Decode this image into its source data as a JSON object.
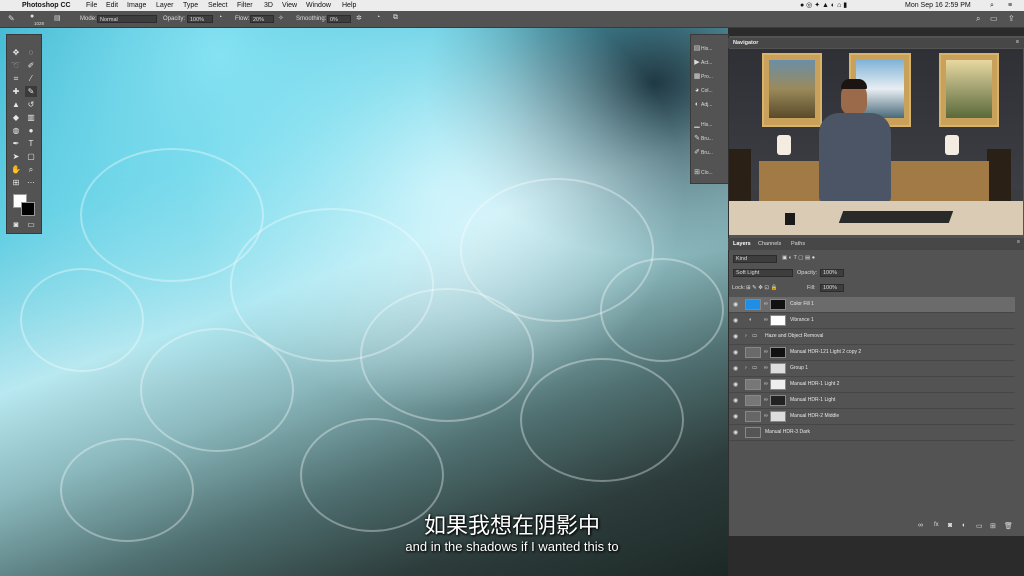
{
  "menubar": {
    "app_name": "Photoshop CC",
    "items": [
      "File",
      "Edit",
      "Image",
      "Layer",
      "Type",
      "Select",
      "Filter",
      "3D",
      "View",
      "Window",
      "Help"
    ],
    "clock": "Mon Sep 16  2:59 PM"
  },
  "options_bar": {
    "brush_size": "1028",
    "mode_label": "Mode:",
    "mode_value": "Normal",
    "opacity_label": "Opacity:",
    "opacity_value": "100%",
    "flow_label": "Flow:",
    "flow_value": "20%",
    "smoothing_label": "Smoothing:",
    "smoothing_value": "0%"
  },
  "mini_panel": {
    "items": [
      {
        "label": "His...",
        "icon": "history-icon"
      },
      {
        "label": "Act...",
        "icon": "actions-icon"
      },
      {
        "label": "Pro...",
        "icon": "properties-icon"
      },
      {
        "label": "Col...",
        "icon": "color-icon"
      },
      {
        "label": "Adj...",
        "icon": "adjustments-icon"
      },
      {
        "label": "His...",
        "icon": "histogram-icon"
      },
      {
        "label": "Bru...",
        "icon": "brush-icon"
      },
      {
        "label": "Bru...",
        "icon": "brush-settings-icon"
      },
      {
        "label": "Clo...",
        "icon": "clone-source-icon"
      }
    ]
  },
  "navigator": {
    "title": "Navigator"
  },
  "layers_panel": {
    "tabs": [
      "Layers",
      "Channels",
      "Paths"
    ],
    "filter_kind": "Kind",
    "blend_mode": "Soft Light",
    "opacity_label": "Opacity:",
    "opacity_value": "100%",
    "lock_label": "Lock:",
    "fill_label": "Fill:",
    "fill_value": "100%",
    "layers": [
      {
        "name": "Color Fill 1",
        "selected": true
      },
      {
        "name": "Vibrance 1",
        "selected": false
      },
      {
        "name": "Haze and Object Removal",
        "selected": false
      },
      {
        "name": "Manual HDR-121 Light 2 copy 2",
        "selected": false
      },
      {
        "name": "Group 1",
        "selected": false
      },
      {
        "name": "Manual HDR-1 Light 2",
        "selected": false
      },
      {
        "name": "Manual HDR-1 Light",
        "selected": false
      },
      {
        "name": "Manual HDR-2 Middle",
        "selected": false
      },
      {
        "name": "Manual HDR-3 Dark",
        "selected": false
      }
    ]
  },
  "subtitles": {
    "chinese": "如果我想在阴影中",
    "english": "and in the shadows if I wanted this to"
  },
  "colors": {
    "accent_fill": "#1e8fe6",
    "selected_row": "#6b6b6b"
  }
}
